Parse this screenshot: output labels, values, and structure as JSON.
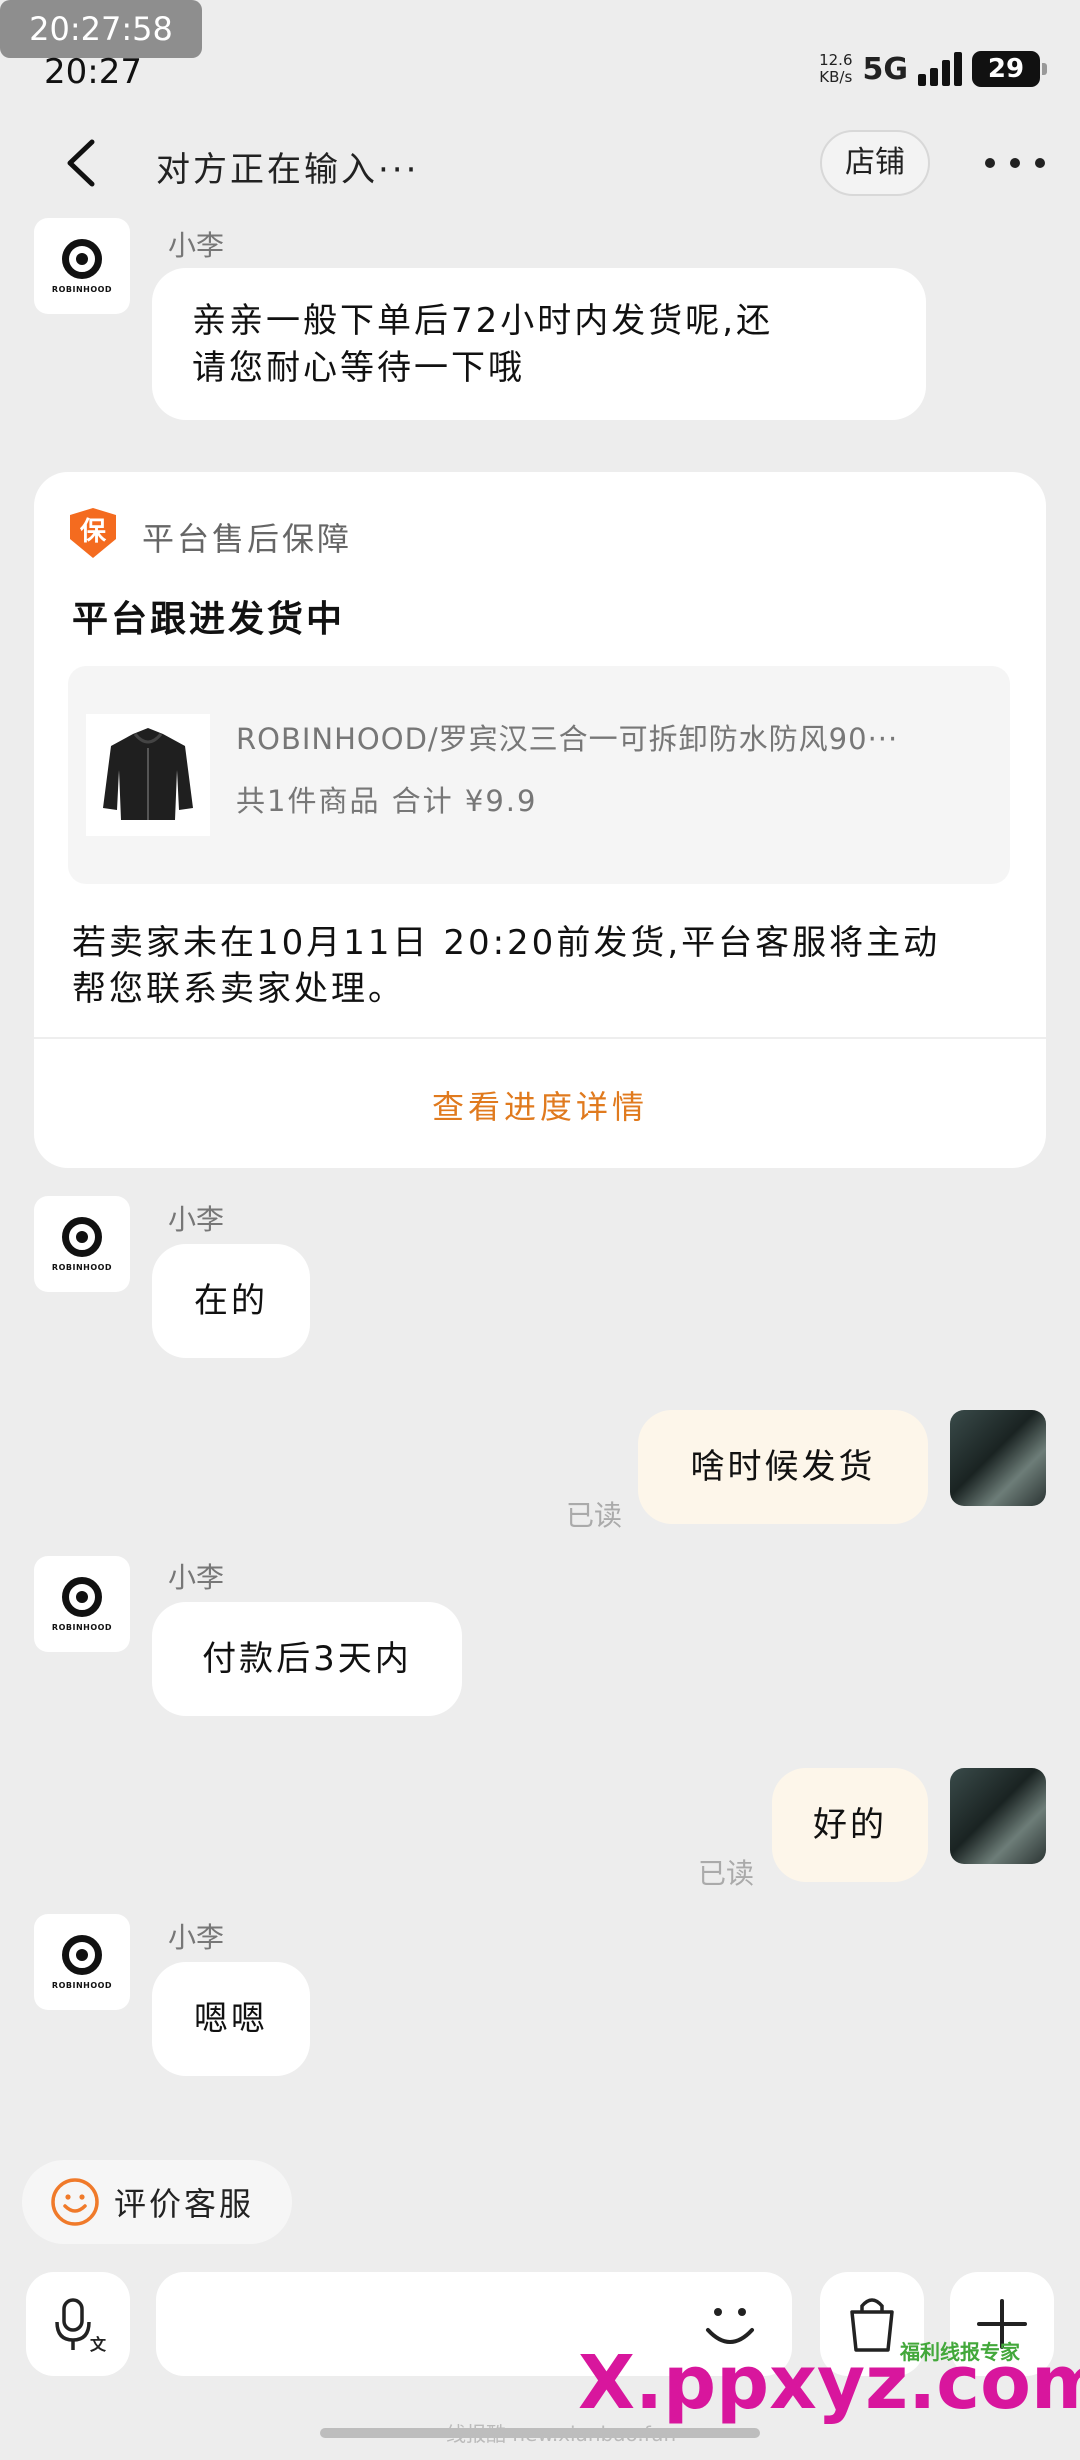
{
  "overlay": {
    "timestamp": "20:27:58"
  },
  "status_bar": {
    "time": "20:27",
    "net_speed_value": "12.6",
    "net_speed_unit": "KB/s",
    "network": "5G",
    "battery": "29"
  },
  "header": {
    "title": "对方正在输入···",
    "shop_button": "店铺"
  },
  "shop": {
    "logo_text": "ROBINHOOD"
  },
  "messages": [
    {
      "sender": "小李",
      "text_line1": "亲亲一般下单后72小时内发货呢,还",
      "text_line2": "请您耐心等待一下哦"
    },
    {
      "sender": "小李",
      "text": "在的"
    },
    {
      "me": true,
      "text": "啥时候发货",
      "read": "已读"
    },
    {
      "sender": "小李",
      "text": "付款后3天内"
    },
    {
      "me": true,
      "text": "好的",
      "read": "已读"
    },
    {
      "sender": "小李",
      "text": "嗯嗯"
    }
  ],
  "card": {
    "badge": "保",
    "label": "平台售后保障",
    "title": "平台跟进发货中",
    "product_name": "ROBINHOOD/罗宾汉三合一可拆卸防水防风90···",
    "product_meta": "共1件商品  合计 ¥9.9",
    "notice_line1": "若卖家未在10月11日 20:20前发货,平台客服将主动",
    "notice_line2": "帮您联系卖家处理。",
    "link": "查看进度详情"
  },
  "rate": {
    "label": "评价客服"
  },
  "colors": {
    "accent": "#e07a1e",
    "bubble_me": "#fdf6ea",
    "background": "#ededed",
    "badge": "#f46b1f"
  },
  "watermark": {
    "text": "X.ppxyz.com",
    "sub": "福利线报专家",
    "bottom": "线报酷 new.xianbao.fun"
  }
}
